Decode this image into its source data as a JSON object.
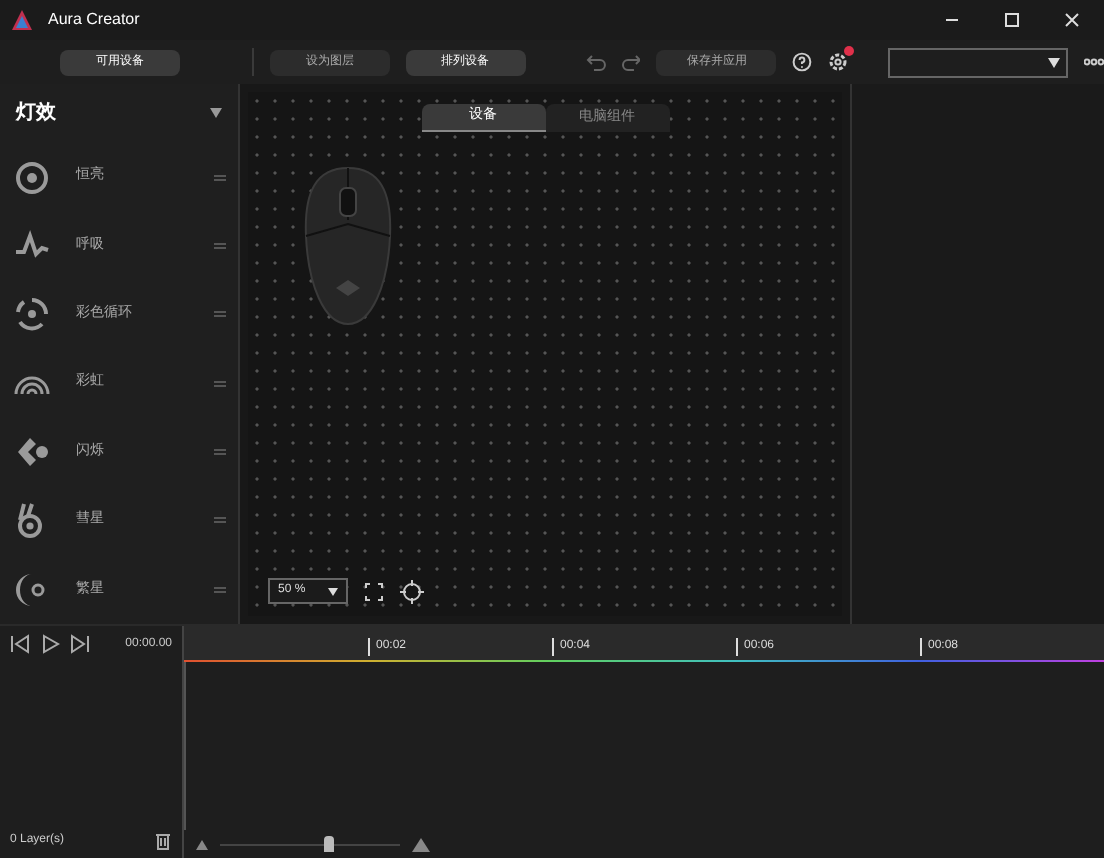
{
  "window": {
    "title": "Aura Creator"
  },
  "toolbar": {
    "buttons": [
      {
        "label": "可用设备",
        "kind": "primary"
      },
      {
        "label": "设为图层",
        "kind": "normal"
      },
      {
        "label": "排列设备",
        "kind": "primary"
      },
      {
        "label": "保存并应用",
        "kind": "normal"
      }
    ]
  },
  "effects_panel": {
    "title": "灯效",
    "items": [
      {
        "label": "恒亮",
        "kind": "static"
      },
      {
        "label": "呼吸",
        "kind": "breathing"
      },
      {
        "label": "彩色循环",
        "kind": "cycle"
      },
      {
        "label": "彩虹",
        "kind": "rainbow"
      },
      {
        "label": "闪烁",
        "kind": "strobe"
      },
      {
        "label": "彗星",
        "kind": "comet"
      },
      {
        "label": "繁星",
        "kind": "star"
      }
    ]
  },
  "canvas": {
    "tabs": [
      {
        "label": "设备",
        "selected": true
      },
      {
        "label": "电脑组件",
        "selected": false
      }
    ],
    "zoom": "50 %"
  },
  "timeline": {
    "time": "00:00.00",
    "ticks": [
      "00:02",
      "00:04",
      "00:06",
      "00:08"
    ],
    "layers": "0 Layer(s)",
    "zoom_slider": {
      "level": 0.6
    }
  }
}
